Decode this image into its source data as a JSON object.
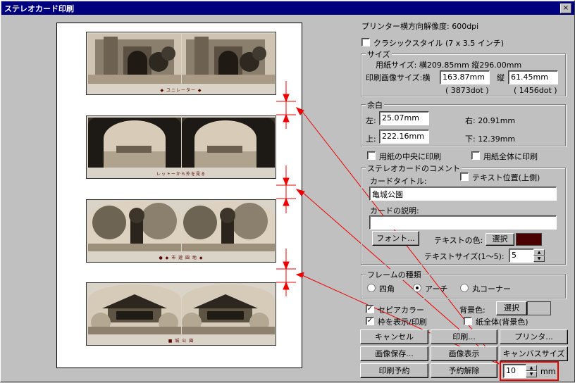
{
  "window": {
    "title": "ステレオカード印刷",
    "close_icon": "×"
  },
  "preview": {
    "cards": [
      {
        "caption": "◆ ユニレーター ◆"
      },
      {
        "caption": "レットーから外を見る"
      },
      {
        "caption": "● ◆ 市 遊 園 地 ◆"
      },
      {
        "caption": "■ 城 公 園"
      }
    ]
  },
  "printer_resolution": "プリンター横方向解像度: 600dpi",
  "classic_style": {
    "label": "クラシックスタイル (7 x 3.5 インチ)",
    "checked": false
  },
  "size": {
    "group_title": "サイズ",
    "paper_size": "用紙サイズ: 横209.85mm 縦296.00mm",
    "image_width_label": "印刷画像サイズ:横",
    "image_width": "163.87mm",
    "image_width_dots": "( 3873dot )",
    "image_height_label": "縦",
    "image_height": "61.45mm",
    "image_height_dots": "( 1456dot )"
  },
  "margin": {
    "group_title": "余白",
    "left_label": "左:",
    "left": "25.07mm",
    "top_label": "上:",
    "top": "222.16mm",
    "right_label": "右: 20.91mm",
    "bottom_label": "下: 12.39mm"
  },
  "center_print": {
    "label": "用紙の中央に印刷",
    "checked": false
  },
  "full_print": {
    "label": "用紙全体に印刷",
    "checked": false
  },
  "comment": {
    "group_title": "ステレオカードのコメント",
    "text_position": "テキスト位置(上側)",
    "card_title_label": "カードタイトル:",
    "card_title": "亀城公園",
    "card_desc_label": "カードの説明:",
    "card_desc": "",
    "font_button": "フォント...",
    "text_color_label": "テキストの色:",
    "select_button": "選択",
    "text_color": "#4a0000",
    "text_size_label": "テキストサイズ(1〜5):",
    "text_size": "5"
  },
  "frame": {
    "group_title": "フレームの種類",
    "options": [
      "四角",
      "アーチ",
      "丸コーナー"
    ],
    "selected": "アーチ"
  },
  "sepia": {
    "label": "セピアカラー",
    "checked": true
  },
  "show_frame": {
    "label": "枠を表示/印刷",
    "checked": true
  },
  "background": {
    "label": "背景色:",
    "select_button": "選択",
    "whole_paper": "紙全体(背景色)"
  },
  "buttons": {
    "cancel": "キャンセル",
    "print": "印刷...",
    "printer": "プリンタ...",
    "save_image": "画像保存...",
    "show_image": "画像表示",
    "canvas_size": "キャンバスサイズ",
    "reserve_print": "印刷予約",
    "cancel_reserve": "予約解除"
  },
  "gap": {
    "value": "10",
    "unit": "mm"
  }
}
